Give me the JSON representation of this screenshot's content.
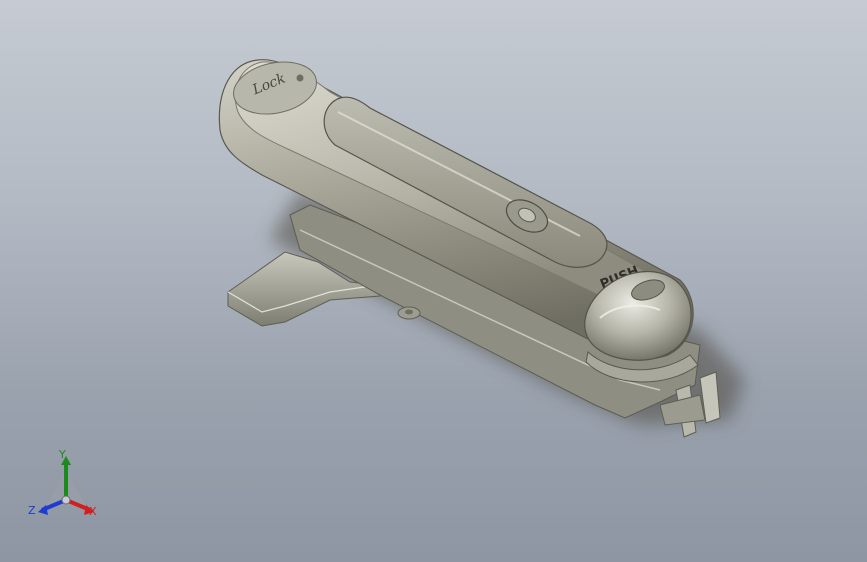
{
  "viewport": {
    "background_colors": [
      "#c6cbd2",
      "#9aa2ae",
      "#8e96a3"
    ]
  },
  "model": {
    "description_icon": "swing-handle-lock-icon",
    "body_color": "#9b9a8c",
    "cap_label": "PUSH",
    "logo_text": "Lock"
  },
  "triad": {
    "x_label": "X",
    "y_label": "Y",
    "z_label": "Z",
    "x_color": "#d11f1f",
    "y_color": "#1c8a1c",
    "z_color": "#1f3bd1"
  }
}
